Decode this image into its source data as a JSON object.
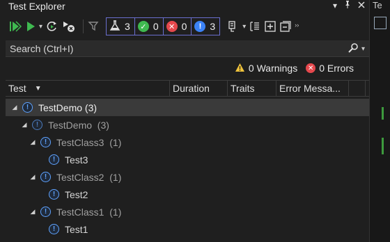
{
  "window": {
    "title": "Test Explorer"
  },
  "title_actions": {
    "dropdown_glyph": "▾",
    "pin_glyph": "📌",
    "close_glyph": "✕"
  },
  "toolbar": {
    "counters": {
      "total": "3",
      "passed": "0",
      "failed": "0",
      "not_run": "3"
    }
  },
  "search": {
    "placeholder": "Search (Ctrl+I)"
  },
  "summary": {
    "warnings": "0 Warnings",
    "errors": "0 Errors"
  },
  "columns": [
    "Test",
    "Duration",
    "Traits",
    "Error Messa..."
  ],
  "tree": [
    {
      "label": "TestDemo (3)",
      "level": "root"
    },
    {
      "label": "TestDemo  (3)",
      "level": "project"
    },
    {
      "label": "TestClass3  (1)",
      "level": "class"
    },
    {
      "label": "Test3",
      "level": "test"
    },
    {
      "label": "TestClass2  (1)",
      "level": "class"
    },
    {
      "label": "Test2",
      "level": "test"
    },
    {
      "label": "TestClass1  (1)",
      "level": "class"
    },
    {
      "label": "Test1",
      "level": "test"
    }
  ],
  "right_strip": {
    "tab_label": "Te"
  },
  "colors": {
    "accent_border": "#6a6fcf",
    "passed": "#3fb950",
    "failed": "#e5484d",
    "notrun": "#3b82f6",
    "info": "#5fa3ff"
  }
}
